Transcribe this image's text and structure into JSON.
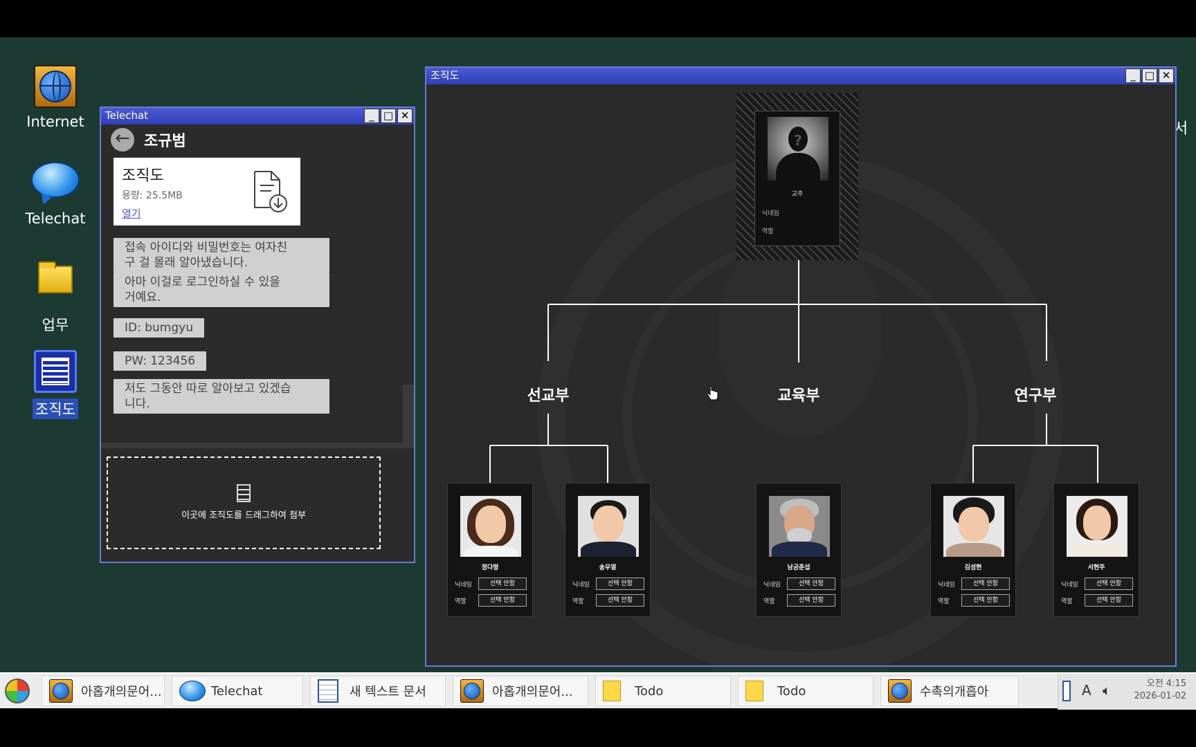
{
  "desktop": {
    "icons": [
      {
        "label": "Internet",
        "icon": "globe-icon"
      },
      {
        "label": "Telechat",
        "icon": "chat-bubble-icon"
      },
      {
        "label": "업무",
        "icon": "folder-icon"
      },
      {
        "label": "조직도",
        "icon": "document-icon"
      }
    ],
    "edge_text": "서"
  },
  "telechat": {
    "title": "Telechat",
    "contact_name": "조규범",
    "file": {
      "name": "조직도",
      "size": "용량: 25.5MB",
      "open": "열기"
    },
    "messages": [
      {
        "line1": "접속 아이디와 비밀번호는 여자친",
        "line2": "구 걸 몰래 알아냈습니다."
      },
      {
        "line1": "아마 이걸로 로그인하실 수 있을",
        "line2": "거예요."
      },
      {
        "line1": "ID: bumgyu"
      },
      {
        "line1": "PW: 123456"
      },
      {
        "line1": "저도 그동안 따로 알아보고 있겠습",
        "line2": "니다."
      }
    ],
    "drop_text": "이곳에 조직도를 드래그하여 첨부"
  },
  "org": {
    "title": "조직도",
    "boss": {
      "name": "교주",
      "nick_label": "닉네임",
      "role_label": "역할"
    },
    "departments": [
      "선교부",
      "교육부",
      "연구부"
    ],
    "members": [
      {
        "name": "정다령",
        "nick_label": "닉네임",
        "role_label": "역할",
        "nick": "선택 안함",
        "role": "선택 안함"
      },
      {
        "name": "송우열",
        "nick_label": "닉네임",
        "role_label": "역할",
        "nick": "선택 안함",
        "role": "선택 안함"
      },
      {
        "name": "남궁춘섭",
        "nick_label": "닉네임",
        "role_label": "역할",
        "nick": "선택 안함",
        "role": "선택 안함"
      },
      {
        "name": "김성현",
        "nick_label": "닉네임",
        "role_label": "역할",
        "nick": "선택 안함",
        "role": "선택 안함"
      },
      {
        "name": "서현주",
        "nick_label": "닉네임",
        "role_label": "역할",
        "nick": "선택 안함",
        "role": "선택 안함"
      }
    ]
  },
  "taskbar": {
    "tasks": [
      {
        "label": "아홉개의문어...",
        "icon": "globe-icon"
      },
      {
        "label": "Telechat",
        "icon": "chat-bubble-icon"
      },
      {
        "label": "새 텍스트 문서",
        "icon": "notepad-icon"
      },
      {
        "label": "아홉개의문어...",
        "icon": "globe-icon"
      },
      {
        "label": "Todo",
        "icon": "sticky-note-icon"
      },
      {
        "label": "Todo",
        "icon": "sticky-note-icon"
      },
      {
        "label": "수촉의개흡아",
        "icon": "globe-icon"
      }
    ],
    "ime": "A",
    "clock_time": "오전 4:15",
    "clock_date": "2026-01-02"
  },
  "colors": {
    "desktop": "#1c3a32",
    "titlebar": "#3a4ac4",
    "window_border": "#6a7ad8"
  }
}
